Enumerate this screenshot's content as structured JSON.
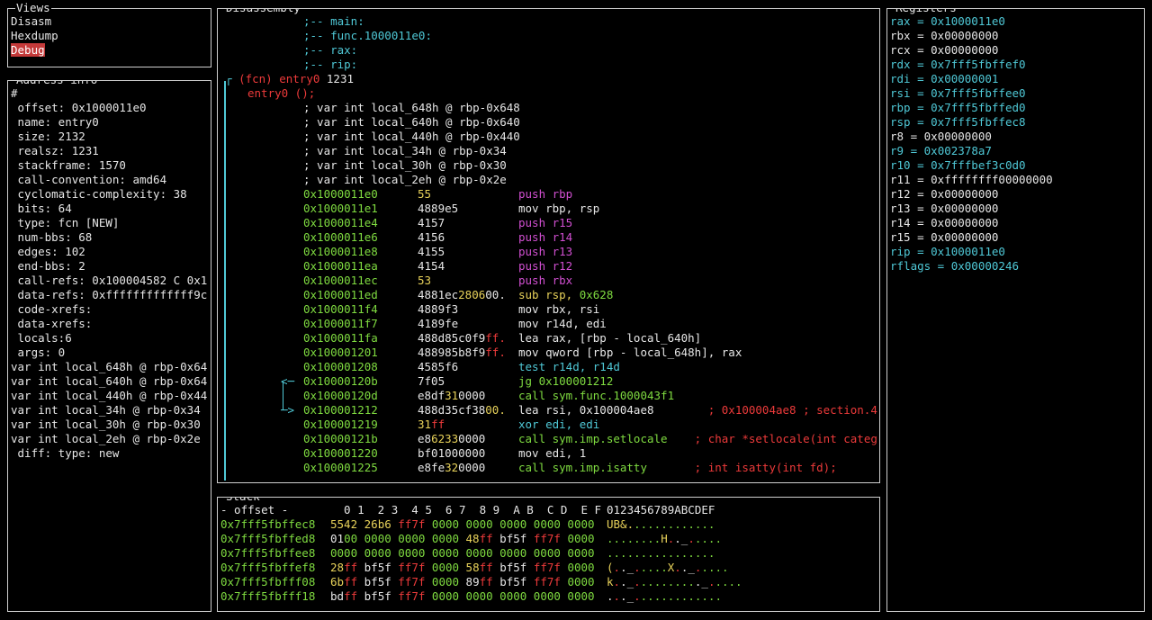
{
  "colors": {
    "border": "#cfcfcf",
    "text": "#e6e6e6",
    "cyan": "#4fc8d6",
    "green": "#7fdb40",
    "yellow": "#e8d25a",
    "magenta": "#d14fd1",
    "red": "#ec3a3a",
    "selection": "#c43a3a"
  },
  "views": {
    "title": "Views",
    "items": [
      {
        "label": "Disasm",
        "selected": false
      },
      {
        "label": "Hexdump",
        "selected": false
      },
      {
        "label": "Debug",
        "selected": true
      }
    ]
  },
  "address_info": {
    "title": "Address info",
    "lines": [
      "#",
      " offset: 0x1000011e0",
      " name: entry0",
      " size: 2132",
      " realsz: 1231",
      " stackframe: 1570",
      " call-convention: amd64",
      " cyclomatic-complexity: 38",
      " bits: 64",
      " type: fcn [NEW]",
      " num-bbs: 68",
      " edges: 102",
      " end-bbs: 2",
      " call-refs: 0x100004582 C 0x1",
      " data-refs: 0xfffffffffffff9c",
      " code-xrefs:",
      " data-xrefs:",
      " locals:6",
      " args: 0",
      "var int local_648h @ rbp-0x64",
      "var int local_640h @ rbp-0x64",
      "var int local_440h @ rbp-0x44",
      "var int local_34h @ rbp-0x34",
      "var int local_30h @ rbp-0x30",
      "var int local_2eh @ rbp-0x2e",
      " diff: type: new"
    ]
  },
  "disassembly": {
    "title": "Disassembly",
    "flags": [
      ";-- main:",
      ";-- func.1000011e0:",
      ";-- rax:",
      ";-- rip:"
    ],
    "fcn_prefix": "(fcn) entry0",
    "fcn_size": " 1231",
    "fcn_proto": "entry0 ();",
    "vars": [
      "; var int local_648h @ rbp-0x648",
      "; var int local_640h @ rbp-0x640",
      "; var int local_440h @ rbp-0x440",
      "; var int local_34h @ rbp-0x34",
      "; var int local_30h @ rbp-0x30",
      "; var int local_2eh @ rbp-0x2e"
    ],
    "instructions": [
      {
        "addr": "0x1000011e0",
        "bytes": [
          [
            "55",
            "y"
          ]
        ],
        "ops": [
          [
            "push rbp",
            "m"
          ]
        ],
        "arrow": ""
      },
      {
        "addr": "0x1000011e1",
        "bytes": [
          [
            "4889e5",
            "w"
          ]
        ],
        "ops": [
          [
            "mov rbp, rsp",
            "w"
          ]
        ],
        "arrow": ""
      },
      {
        "addr": "0x1000011e4",
        "bytes": [
          [
            "4157",
            "w"
          ]
        ],
        "ops": [
          [
            "push r15",
            "m"
          ]
        ],
        "arrow": ""
      },
      {
        "addr": "0x1000011e6",
        "bytes": [
          [
            "4156",
            "w"
          ]
        ],
        "ops": [
          [
            "push r14",
            "m"
          ]
        ],
        "arrow": ""
      },
      {
        "addr": "0x1000011e8",
        "bytes": [
          [
            "4155",
            "w"
          ]
        ],
        "ops": [
          [
            "push r13",
            "m"
          ]
        ],
        "arrow": ""
      },
      {
        "addr": "0x1000011ea",
        "bytes": [
          [
            "4154",
            "w"
          ]
        ],
        "ops": [
          [
            "push r12",
            "m"
          ]
        ],
        "arrow": ""
      },
      {
        "addr": "0x1000011ec",
        "bytes": [
          [
            "53",
            "y"
          ]
        ],
        "ops": [
          [
            "push rbx",
            "m"
          ]
        ],
        "arrow": ""
      },
      {
        "addr": "0x1000011ed",
        "bytes": [
          [
            "4881ec",
            "w"
          ],
          [
            "2806",
            "y"
          ],
          [
            "00.",
            "w"
          ]
        ],
        "ops": [
          [
            "sub rsp, ",
            "y"
          ],
          [
            "0x628",
            "g"
          ]
        ],
        "arrow": ""
      },
      {
        "addr": "0x1000011f4",
        "bytes": [
          [
            "4889f3",
            "w"
          ]
        ],
        "ops": [
          [
            "mov rbx, rsi",
            "w"
          ]
        ],
        "arrow": ""
      },
      {
        "addr": "0x1000011f7",
        "bytes": [
          [
            "4189fe",
            "w"
          ]
        ],
        "ops": [
          [
            "mov r14d, edi",
            "w"
          ]
        ],
        "arrow": ""
      },
      {
        "addr": "0x1000011fa",
        "bytes": [
          [
            "488d85c0f9",
            "w"
          ],
          [
            "ff.",
            "r"
          ]
        ],
        "ops": [
          [
            "lea rax, [rbp - local_640h]",
            "w"
          ]
        ],
        "arrow": ""
      },
      {
        "addr": "0x100001201",
        "bytes": [
          [
            "488985b8f9",
            "w"
          ],
          [
            "ff.",
            "r"
          ]
        ],
        "ops": [
          [
            "mov qword [rbp - local_648h], rax",
            "w"
          ]
        ],
        "arrow": ""
      },
      {
        "addr": "0x100001208",
        "bytes": [
          [
            "4585f6",
            "w"
          ]
        ],
        "ops": [
          [
            "test r14d, r14d",
            "c"
          ]
        ],
        "arrow": ""
      },
      {
        "addr": "0x10000120b",
        "bytes": [
          [
            "7f05",
            "w"
          ]
        ],
        "ops": [
          [
            "jg 0x100001212",
            "g"
          ]
        ],
        "arrow": "<"
      },
      {
        "addr": "0x10000120d",
        "bytes": [
          [
            "e8df",
            "w"
          ],
          [
            "31",
            "y"
          ],
          [
            "0000",
            "w"
          ]
        ],
        "ops": [
          [
            "call sym.func.1000043f1",
            "g"
          ]
        ],
        "arrow": ""
      },
      {
        "addr": "0x100001212",
        "bytes": [
          [
            "488d35cf38",
            "w"
          ],
          [
            "00.",
            "y"
          ]
        ],
        "ops": [
          [
            "lea rsi, 0x100004ae8",
            "w"
          ],
          [
            "        ; 0x100004ae8 ; section.4.",
            "r"
          ]
        ],
        "arrow": ">"
      },
      {
        "addr": "0x100001219",
        "bytes": [
          [
            "31",
            "y"
          ],
          [
            "ff",
            "r"
          ]
        ],
        "ops": [
          [
            "xor edi, edi",
            "c"
          ]
        ],
        "arrow": ""
      },
      {
        "addr": "0x10000121b",
        "bytes": [
          [
            "e8",
            "w"
          ],
          [
            "6233",
            "y"
          ],
          [
            "0000",
            "w"
          ]
        ],
        "ops": [
          [
            "call sym.imp.setlocale",
            "g"
          ],
          [
            "    ; char *setlocale(int categ",
            "r"
          ]
        ],
        "arrow": ""
      },
      {
        "addr": "0x100001220",
        "bytes": [
          [
            "bf01000000",
            "w"
          ]
        ],
        "ops": [
          [
            "mov edi, 1",
            "w"
          ]
        ],
        "arrow": ""
      },
      {
        "addr": "0x100001225",
        "bytes": [
          [
            "e8fe",
            "w"
          ],
          [
            "32",
            "y"
          ],
          [
            "0000",
            "w"
          ]
        ],
        "ops": [
          [
            "call sym.imp.isatty",
            "g"
          ],
          [
            "       ; int isatty(int fd);",
            "r"
          ]
        ],
        "arrow": ""
      }
    ]
  },
  "registers": {
    "title": "Registers",
    "items": [
      {
        "name": "rax",
        "value": "0x1000011e0",
        "changed": true
      },
      {
        "name": "rbx",
        "value": "0x00000000",
        "changed": false
      },
      {
        "name": "rcx",
        "value": "0x00000000",
        "changed": false
      },
      {
        "name": "rdx",
        "value": "0x7fff5fbffef0",
        "changed": true
      },
      {
        "name": "rdi",
        "value": "0x00000001",
        "changed": true
      },
      {
        "name": "rsi",
        "value": "0x7fff5fbffee0",
        "changed": true
      },
      {
        "name": "rbp",
        "value": "0x7fff5fbffed0",
        "changed": true
      },
      {
        "name": "rsp",
        "value": "0x7fff5fbffec8",
        "changed": true
      },
      {
        "name": "r8",
        "value": "0x00000000",
        "changed": false
      },
      {
        "name": "r9",
        "value": "0x002378a7",
        "changed": true
      },
      {
        "name": "r10",
        "value": "0x7fffbef3c0d0",
        "changed": true
      },
      {
        "name": "r11",
        "value": "0xffffffff00000000",
        "changed": false
      },
      {
        "name": "r12",
        "value": "0x00000000",
        "changed": false
      },
      {
        "name": "r13",
        "value": "0x00000000",
        "changed": false
      },
      {
        "name": "r14",
        "value": "0x00000000",
        "changed": false
      },
      {
        "name": "r15",
        "value": "0x00000000",
        "changed": false
      },
      {
        "name": "rip",
        "value": "0x1000011e0",
        "changed": true
      },
      {
        "name": "rflags",
        "value": "0x00000246",
        "changed": true
      }
    ]
  },
  "stack": {
    "title": "Stack",
    "header": {
      "offset": "- offset -",
      "cols": "  0 1  2 3  4 5  6 7  8 9  A B  C D  E F",
      "ascii": "0123456789ABCDEF"
    },
    "rows": [
      {
        "addr": "0x7fff5fbffec8",
        "hex": [
          [
            "5542",
            "y"
          ],
          [
            " ",
            "w"
          ],
          [
            "26b6",
            "y"
          ],
          [
            " ",
            "w"
          ],
          [
            "ff7f",
            "r"
          ],
          [
            " 0000 0000 0000 0000 0000",
            "g"
          ]
        ],
        "ascii": [
          [
            "UB&.",
            "y"
          ],
          [
            "............",
            "g"
          ]
        ]
      },
      {
        "addr": "0x7fff5fbffed8",
        "hex": [
          [
            "01",
            "w"
          ],
          [
            "00 0000 0000 0000 ",
            "g"
          ],
          [
            "48",
            "y"
          ],
          [
            "ff",
            "r"
          ],
          [
            " bf5f ",
            "w"
          ],
          [
            "ff7f",
            "r"
          ],
          [
            " 0000",
            "g"
          ]
        ],
        "ascii": [
          [
            "........",
            "g"
          ],
          [
            "H",
            "y"
          ],
          [
            ".",
            "r"
          ],
          [
            "._",
            "w"
          ],
          [
            ".",
            "r"
          ],
          [
            "....",
            "g"
          ]
        ]
      },
      {
        "addr": "0x7fff5fbffee8",
        "hex": [
          [
            "0000 0000 0000 0000 0000 0000 0000 0000",
            "g"
          ]
        ],
        "ascii": [
          [
            "................",
            "g"
          ]
        ]
      },
      {
        "addr": "0x7fff5fbffef8",
        "hex": [
          [
            "28",
            "y"
          ],
          [
            "ff",
            "r"
          ],
          [
            " bf5f ",
            "w"
          ],
          [
            "ff7f",
            "r"
          ],
          [
            " 0000 ",
            "g"
          ],
          [
            "58",
            "y"
          ],
          [
            "ff",
            "r"
          ],
          [
            " bf5f ",
            "w"
          ],
          [
            "ff7f",
            "r"
          ],
          [
            " 0000",
            "g"
          ]
        ],
        "ascii": [
          [
            "(",
            "y"
          ],
          [
            ".",
            "r"
          ],
          [
            "._",
            "w"
          ],
          [
            ".",
            "r"
          ],
          [
            "....",
            "g"
          ],
          [
            "X",
            "y"
          ],
          [
            ".",
            "r"
          ],
          [
            "._",
            "w"
          ],
          [
            ".",
            "r"
          ],
          [
            "....",
            "g"
          ]
        ]
      },
      {
        "addr": "0x7fff5fbfff08",
        "hex": [
          [
            "6b",
            "y"
          ],
          [
            "ff",
            "r"
          ],
          [
            " bf5f ",
            "w"
          ],
          [
            "ff7f",
            "r"
          ],
          [
            " 0000 ",
            "g"
          ],
          [
            "89",
            "w"
          ],
          [
            "ff",
            "r"
          ],
          [
            " bf5f ",
            "w"
          ],
          [
            "ff7f",
            "r"
          ],
          [
            " 0000",
            "g"
          ]
        ],
        "ascii": [
          [
            "k",
            "y"
          ],
          [
            ".",
            "r"
          ],
          [
            "._",
            "w"
          ],
          [
            ".",
            "r"
          ],
          [
            "........",
            "g"
          ],
          [
            "._",
            "w"
          ],
          [
            ".",
            "r"
          ],
          [
            "....",
            "g"
          ]
        ]
      },
      {
        "addr": "0x7fff5fbfff18",
        "hex": [
          [
            "bd",
            "w"
          ],
          [
            "ff",
            "r"
          ],
          [
            " bf5f ",
            "w"
          ],
          [
            "ff7f",
            "r"
          ],
          [
            " 0000 0000 0000 0000 0000",
            "g"
          ]
        ],
        "ascii": [
          [
            ".",
            "w"
          ],
          [
            ".",
            "r"
          ],
          [
            "._",
            "w"
          ],
          [
            ".",
            "r"
          ],
          [
            "............",
            "g"
          ]
        ]
      }
    ]
  }
}
